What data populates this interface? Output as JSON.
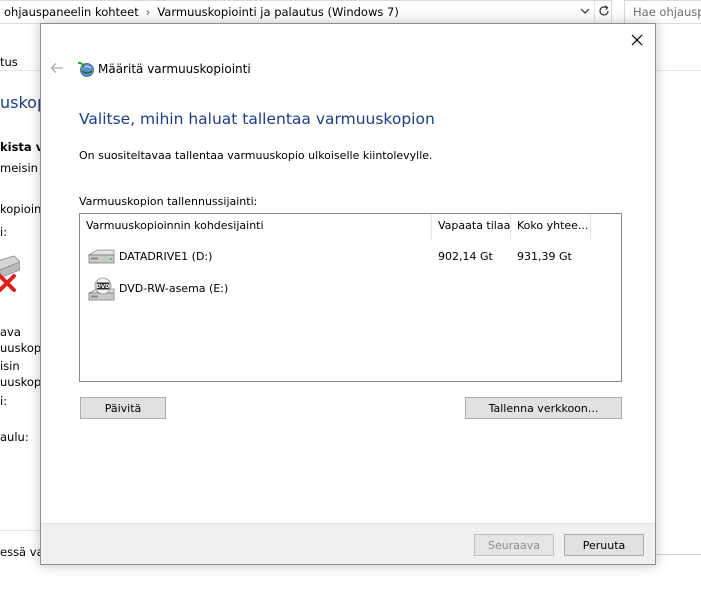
{
  "background": {
    "address_parts": [
      "ohjauspaneelin kohteet",
      "Varmuuskopiointi ja palautus (Windows 7)"
    ],
    "search_placeholder": "Hae ohjauspa",
    "left_fragments": [
      "tus",
      "uskopi",
      "kista va",
      "meisin v",
      "kopiointi",
      "i:",
      "ava",
      "uuskopi",
      "isin",
      "uuskopi",
      "i:",
      "aulu:",
      "essä va"
    ]
  },
  "dialog": {
    "title": "Määritä varmuuskopiointi",
    "heading": "Valitse, mihin haluat tallentaa varmuuskopion",
    "recommendation": "On suositeltavaa tallentaa varmuuskopio ulkoiselle kiintolevylle.",
    "location_label": "Varmuuskopion tallennussijainti:",
    "columns": [
      "Varmuuskopioinnin kohdesijainti",
      "Vapaata tilaa",
      "Koko yhtee..."
    ],
    "rows": [
      {
        "name": "DATADRIVE1 (D:)",
        "free": "902,14 Gt",
        "size": "931,39 Gt",
        "icon": "hard-drive-icon"
      },
      {
        "name": "DVD-RW-asema (E:)",
        "free": "",
        "size": "",
        "icon": "dvd-drive-icon",
        "icon_text": "DVD"
      }
    ],
    "buttons": {
      "refresh": "Päivitä",
      "save_network": "Tallenna verkkoon...",
      "next": "Seuraava",
      "cancel": "Peruuta"
    }
  },
  "colors": {
    "heading": "#1e3d86",
    "footer": "#f0f0f0",
    "button": "#e1e1e1",
    "disabled_text": "#8d8d8d"
  }
}
